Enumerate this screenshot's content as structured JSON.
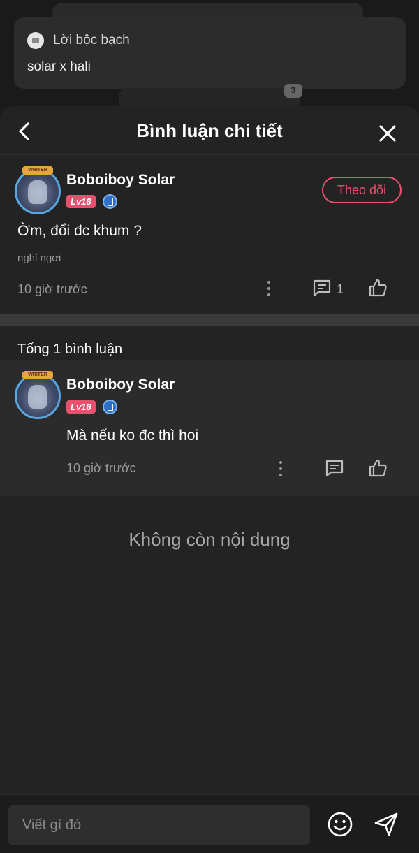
{
  "background": {
    "chip_label": "Lời bộc bạch",
    "card_text": "solar x hali",
    "badge": "3"
  },
  "sheet": {
    "title": "Bình luận chi tiết"
  },
  "main_post": {
    "avatar_crown": "WRITER",
    "username": "Boboiboy Solar",
    "level": "Lv18",
    "follow_label": "Theo dõi",
    "text": "Ờm, đổi đc khum ?",
    "tag": "nghỉ ngơi",
    "time": "10 giờ trước",
    "reply_count": "1"
  },
  "total_comments": "Tổng 1 bình luận",
  "comments": [
    {
      "avatar_crown": "WRITER",
      "username": "Boboiboy Solar",
      "level": "Lv18",
      "text": "Mà nếu ko đc thì hoi",
      "time": "10 giờ trước"
    }
  ],
  "end_message": "Không còn nội dung",
  "composer": {
    "placeholder": "Viết gì đó"
  },
  "colors": {
    "accent": "#e8506e",
    "sheet_bg": "#232323",
    "page_bg": "#1a1a1a"
  }
}
